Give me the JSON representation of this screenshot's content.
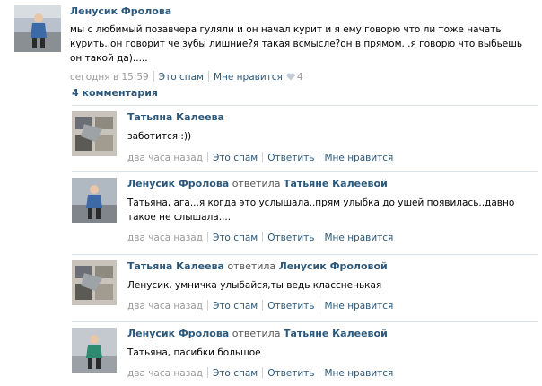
{
  "post": {
    "author": "Ленусик Фролова",
    "text": "мы с любимый позавчера гуляли и он начал курит и я ему говорю что ли тоже начать курить..он говорит че зубы лишние?я такая всмысле?он в прямом...я говорю что выбьешь он такой да).....",
    "time": "сегодня в 15:59",
    "spam": "Это спам",
    "like": "Мне нравится",
    "likes_count": "4",
    "like_icon": "heart-icon"
  },
  "comments_header": "4 комментария",
  "comments": [
    {
      "author": "Татьяна Калеева",
      "verb": "",
      "reply_to": "",
      "text": "заботится :))",
      "time": "два часа назад",
      "spam": "Это спам",
      "reply": "Ответить",
      "like": "Мне нравится"
    },
    {
      "author": "Ленусик Фролова",
      "verb": "ответила",
      "reply_to": "Татьяне Калеевой",
      "text": "Татьяна, ага...я когда это услышала..прям улыбка до ушей появилась..давно такое не слышала....",
      "time": "два часа назад",
      "spam": "Это спам",
      "reply": "Ответить",
      "like": "Мне нравится"
    },
    {
      "author": "Татьяна Калеева",
      "verb": "ответила",
      "reply_to": "Ленусик Фроловой",
      "text": "Ленусик, умничка улыбайся,ты ведь классненькая",
      "time": "два часа назад",
      "spam": "Это спам",
      "reply": "Ответить",
      "like": "Мне нравится"
    },
    {
      "author": "Ленусик Фролова",
      "verb": "ответила",
      "reply_to": "Татьяне Калеевой",
      "text": "Татьяна, пасибки большое",
      "time": "два часа назад",
      "spam": "Это спам",
      "reply": "Ответить",
      "like": "Мне нравится"
    }
  ],
  "colors": {
    "link": "#2b587a",
    "meta": "#999999",
    "divider": "#dae1e8"
  }
}
